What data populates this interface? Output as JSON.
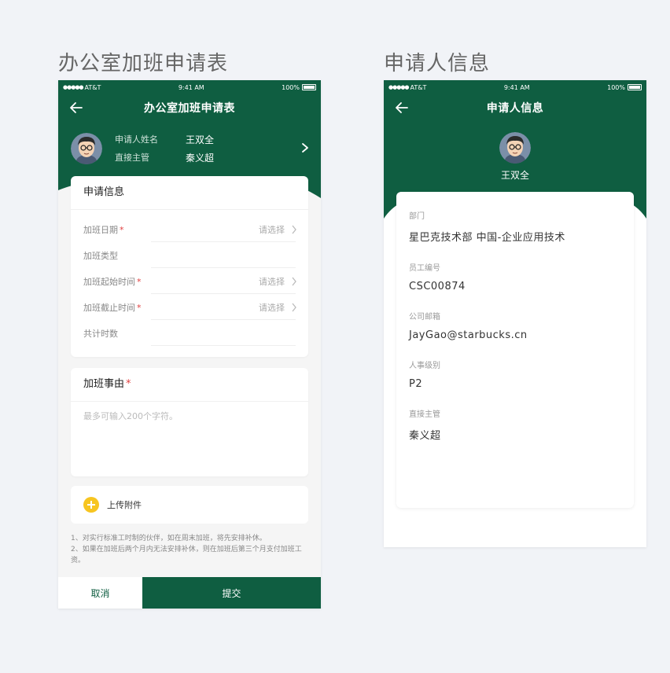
{
  "left_board_title": "办公室加班申请表",
  "right_board_title": "申请人信息",
  "status": {
    "carrier": "AT&T",
    "dots": "●●●●●",
    "time": "9:41 AM",
    "battery": "100%"
  },
  "left": {
    "nav_title": "办公室加班申请表",
    "applicant": {
      "name_label": "申请人姓名",
      "name_value": "王双全",
      "manager_label": "直接主管",
      "manager_value": "秦义超"
    },
    "section_title": "申请信息",
    "rows": [
      {
        "label": "加班日期",
        "required": "*",
        "value": "请选择"
      },
      {
        "label": "加班类型",
        "required": "",
        "value": ""
      },
      {
        "label": "加班起始时间",
        "required": "*",
        "value": "请选择"
      },
      {
        "label": "加班截止时间",
        "required": "*",
        "value": "请选择"
      },
      {
        "label": "共计时数",
        "required": "",
        "value": ""
      }
    ],
    "reason": {
      "title": "加班事由",
      "required": "*",
      "placeholder": "最多可输入200个字符。"
    },
    "upload_label": "上传附件",
    "notes": [
      "1、对实行标准工时制的伙伴，如在周末加班，将先安排补休。",
      "2、如果在加班后两个月内无法安排补休，则在加班后第三个月支付加班工资。"
    ],
    "cancel_label": "取消",
    "submit_label": "提交"
  },
  "right": {
    "nav_title": "申请人信息",
    "name": "王双全",
    "items": [
      {
        "key": "部门",
        "value": "星巴克技术部 中国-企业应用技术"
      },
      {
        "key": "员工编号",
        "value": "CSC00874"
      },
      {
        "key": "公司邮箱",
        "value": "JayGao@starbucks.cn"
      },
      {
        "key": "人事级别",
        "value": "P2"
      },
      {
        "key": "直接主管",
        "value": "秦义超"
      }
    ]
  },
  "colors": {
    "brand_green": "#0f5e41",
    "accent_yellow": "#f7c520",
    "required_red": "#e04040"
  },
  "icons": [
    "back-arrow-icon",
    "chevron-right-icon",
    "plus-icon",
    "avatar",
    "battery-icon"
  ]
}
